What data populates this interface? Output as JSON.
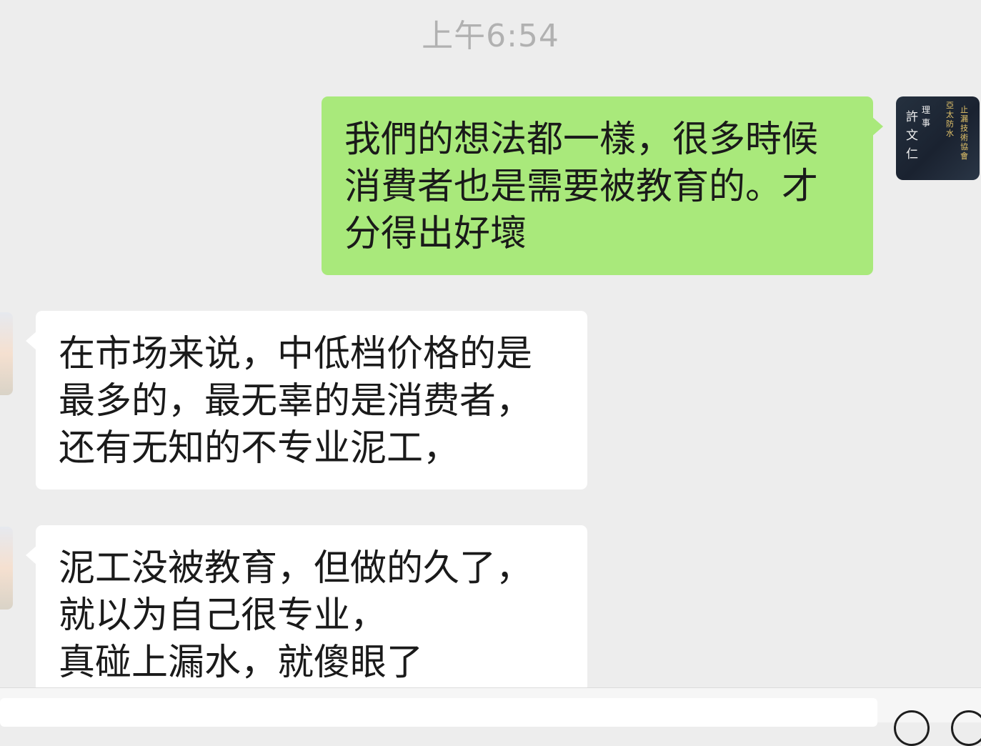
{
  "timestamp": "上午6:54",
  "messages": [
    {
      "sender": "me",
      "text": "我們的想法都一樣，很多時候\n消費者也是需要被教育的。才\n分得出好壞"
    },
    {
      "sender": "other",
      "text": "在市场来说，中低档价格的是\n最多的，最无辜的是消费者，\n还有无知的不专业泥工，"
    },
    {
      "sender": "other",
      "text": "泥工没被教育，但做的久了，\n就以为自己很专业，\n真碰上漏水，就傻眼了"
    }
  ],
  "my_avatar": {
    "name_col": "許文仁",
    "title_col": "理事",
    "assoc_col_1": "亞太防水",
    "assoc_col_2": "止漏技術協會"
  },
  "colors": {
    "background": "#ededed",
    "my_bubble": "#a9e97b",
    "other_bubble": "#ffffff",
    "timestamp": "#b1b1b1"
  },
  "icons": {
    "emoji": "emoji-icon",
    "add": "plus-circle-icon"
  }
}
